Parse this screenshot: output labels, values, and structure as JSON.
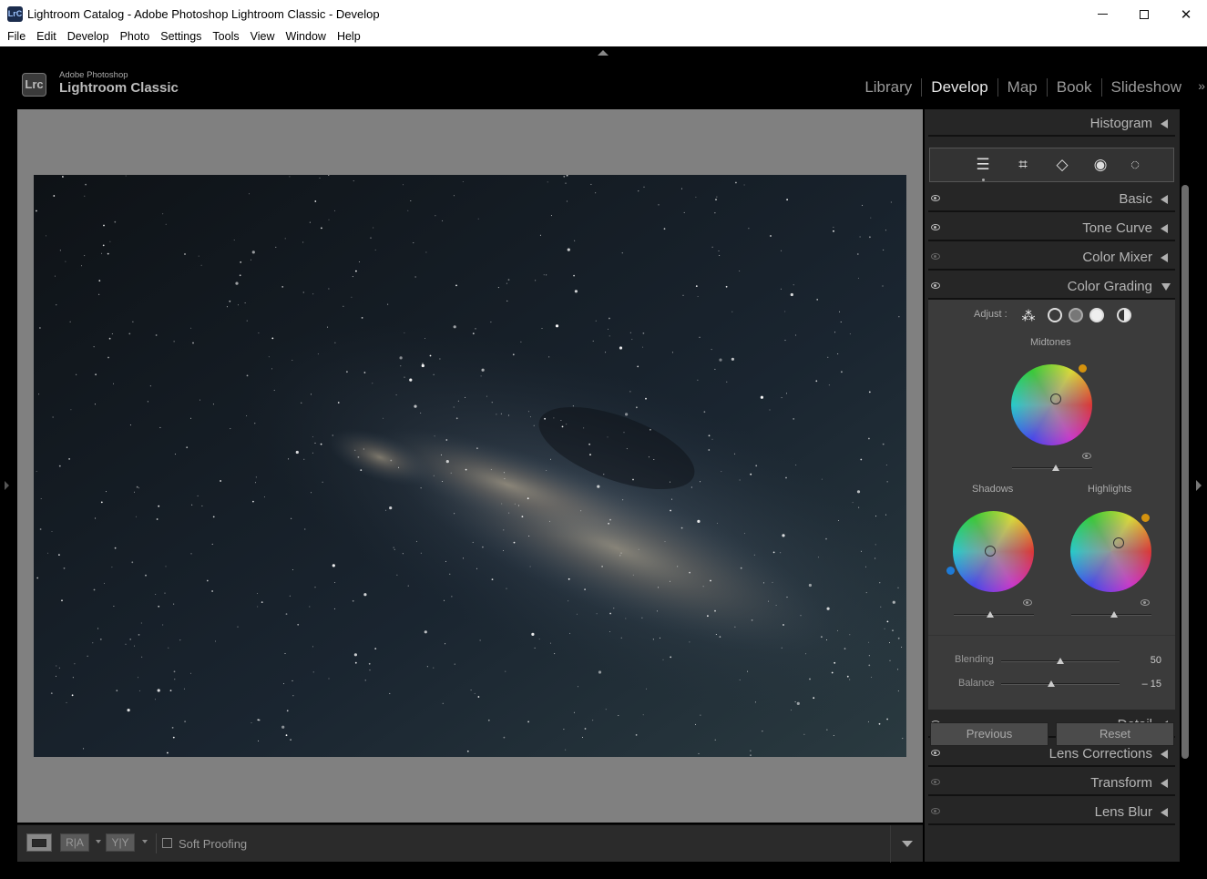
{
  "window": {
    "app_icon_text": "LrC",
    "title": "Lightroom Catalog - Adobe Photoshop Lightroom Classic - Develop"
  },
  "menu": [
    "File",
    "Edit",
    "Develop",
    "Photo",
    "Settings",
    "Tools",
    "View",
    "Window",
    "Help"
  ],
  "brand": {
    "logo": "Lrc",
    "small": "Adobe Photoshop",
    "big": "Lightroom Classic"
  },
  "modules": [
    {
      "label": "Library",
      "active": false
    },
    {
      "label": "Develop",
      "active": true
    },
    {
      "label": "Map",
      "active": false
    },
    {
      "label": "Book",
      "active": false
    },
    {
      "label": "Slideshow",
      "active": false
    }
  ],
  "more_modules": "»",
  "toolbar": {
    "ra": "R|A",
    "yy": "Y|Y",
    "soft_proofing": "Soft Proofing",
    "soft_proofing_checked": false
  },
  "panel": {
    "histogram": "Histogram",
    "sections": {
      "basic": "Basic",
      "tone_curve": "Tone Curve",
      "color_mixer": "Color Mixer",
      "color_grading": "Color Grading",
      "detail": "Detail",
      "lens_corrections": "Lens Corrections",
      "transform": "Transform",
      "lens_blur": "Lens Blur"
    },
    "color_grading": {
      "adjust_label": "Adjust :",
      "midtones": "Midtones",
      "shadows": "Shadows",
      "highlights": "Highlights",
      "blending_label": "Blending",
      "blending_value": "50",
      "blending_fraction": 0.5,
      "balance_label": "Balance",
      "balance_value": "– 15",
      "balance_fraction": 0.425,
      "accent_orange": "#d4920e",
      "accent_blue": "#1e7ad6"
    },
    "previous": "Previous",
    "reset": "Reset"
  }
}
